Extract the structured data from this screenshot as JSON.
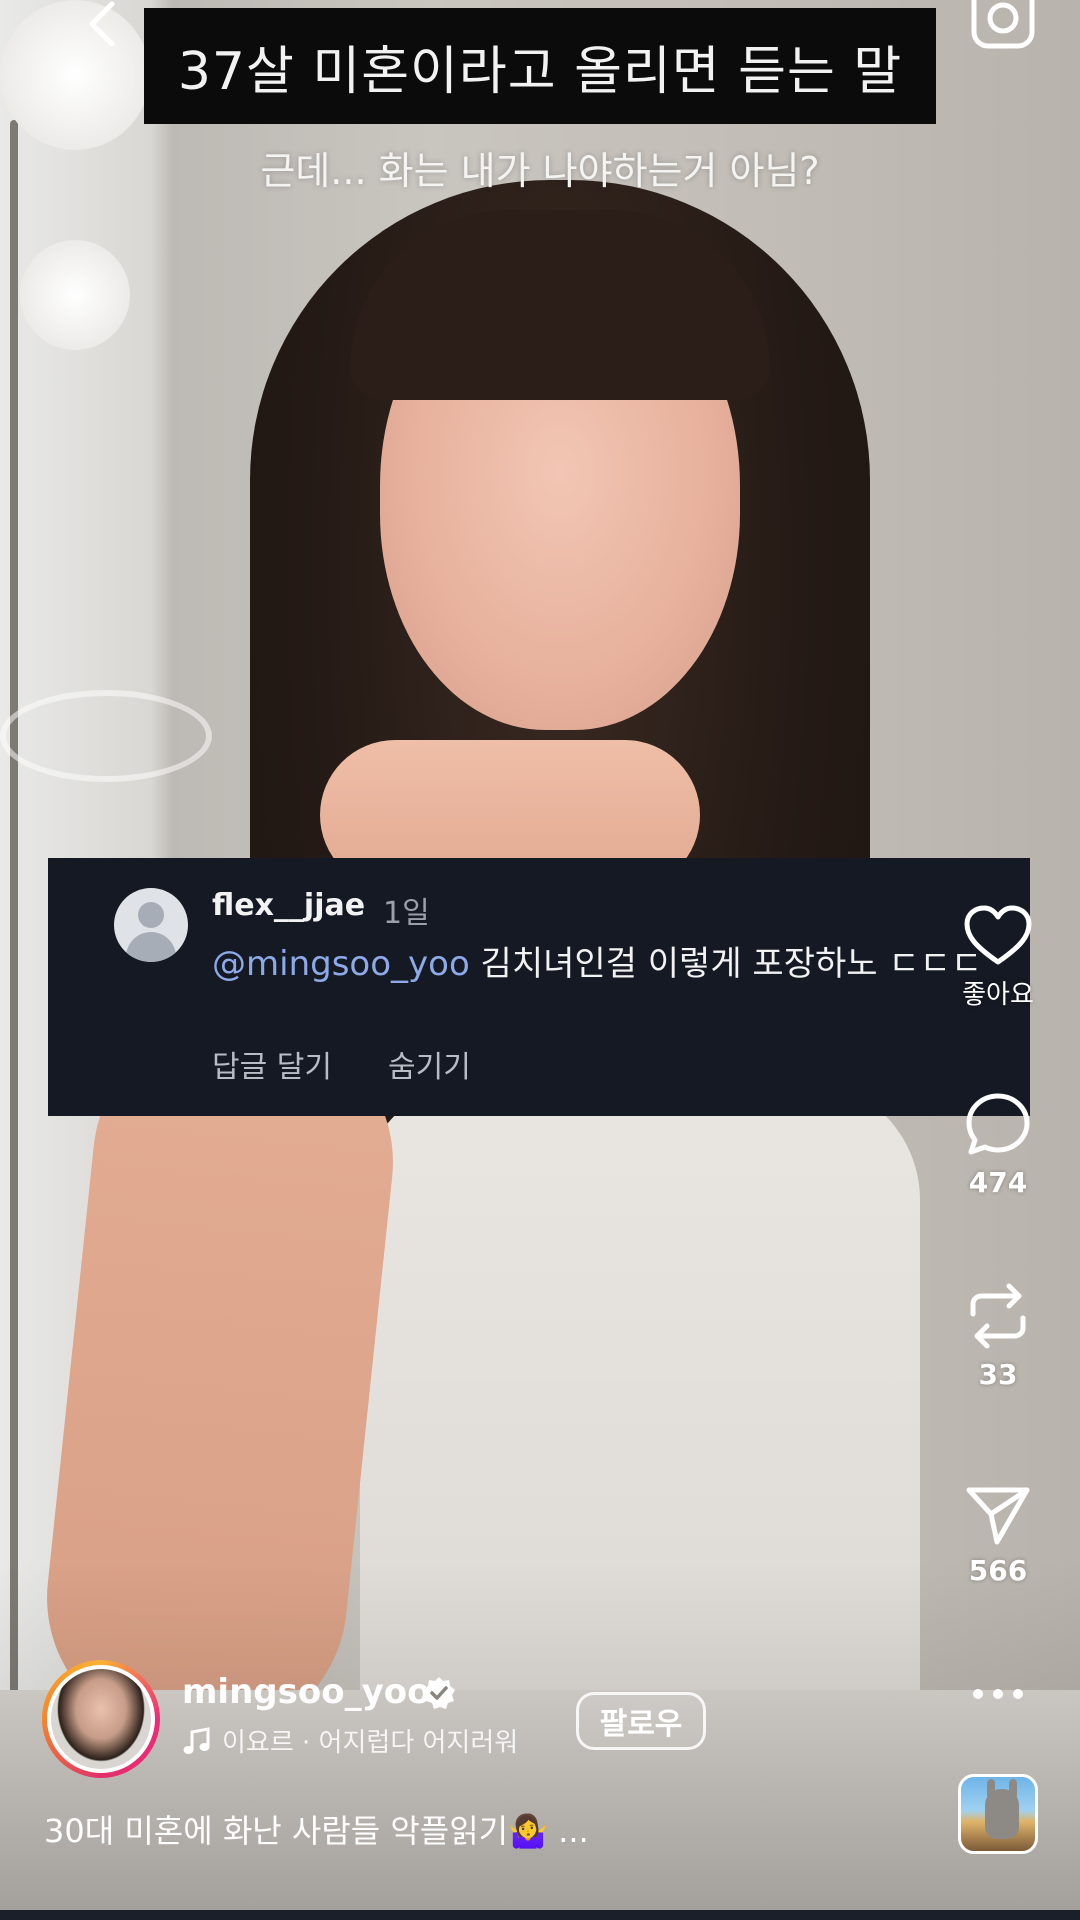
{
  "overlay": {
    "title": "37살 미혼이라고 올리면 듣는 말",
    "subtitle": "근데... 화는 내가 나야하는거 아님?"
  },
  "comment": {
    "username": "flex__jjae",
    "time": "1일",
    "mention": "@mingsoo_yoo",
    "text": " 김치녀인걸 이렇게 포장하노 ㄷㄷㄷ",
    "reply_label": "답글 달기",
    "hide_label": "숨기기"
  },
  "actions": {
    "like_label": "좋아요",
    "comments_count": "474",
    "reposts_count": "33",
    "shares_count": "566"
  },
  "post": {
    "username": "mingsoo_yoo",
    "music": "이요르 · 어지럽다 어지러워",
    "follow_label": "팔로우",
    "caption": "30대 미혼에 화난 사람들 악플읽기🤷‍♀️ ..."
  },
  "colors": {
    "comment_bg": "#141923",
    "mention": "#8da9e8",
    "title_bg": "#0b0b0b"
  },
  "icons": [
    "back-arrow-icon",
    "camera-icon",
    "heart-icon",
    "comment-icon",
    "repost-icon",
    "send-icon",
    "more-icon",
    "music-note-icon",
    "verified-badge-icon"
  ]
}
